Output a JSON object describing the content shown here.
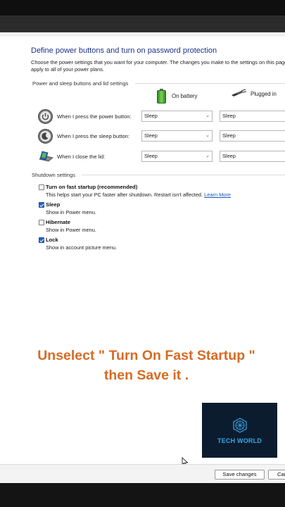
{
  "header": {
    "title": "Define power buttons and turn on password protection",
    "intro": "Choose the power settings that you want for your computer. The changes you make to the settings on this page apply to all of your power plans."
  },
  "power_section": {
    "title": "Power and sleep buttons and lid settings",
    "col_battery": "On battery",
    "col_plugged": "Plugged in",
    "rows": [
      {
        "label": "When I press the power button:",
        "battery": "Sleep",
        "plugged": "Sleep",
        "icon": "power-button-icon"
      },
      {
        "label": "When I press the sleep button:",
        "battery": "Sleep",
        "plugged": "Sleep",
        "icon": "sleep-button-icon"
      },
      {
        "label": "When I close the lid:",
        "battery": "Sleep",
        "plugged": "Sleep",
        "icon": "laptop-lid-icon"
      }
    ]
  },
  "shutdown": {
    "title": "Shutdown settings",
    "items": [
      {
        "label": "Turn on fast startup (recommended)",
        "desc": "This helps start your PC faster after shutdown. Restart isn't affected.",
        "link": "Learn More",
        "checked": false
      },
      {
        "label": "Sleep",
        "desc": "Show in Power menu.",
        "checked": true
      },
      {
        "label": "Hibernate",
        "desc": "Show in Power menu.",
        "checked": false
      },
      {
        "label": "Lock",
        "desc": "Show in account picture menu.",
        "checked": true
      }
    ]
  },
  "overlay": {
    "caption_line1": "Unselect \" Turn On Fast Startup \"",
    "caption_line2": "then Save it .",
    "logo_text": "TECH WORLD",
    "caption_color": "#d86a23",
    "logo_color": "#3aa7e8"
  },
  "footer": {
    "save_label": "Save changes",
    "cancel_label": "Cancel"
  }
}
